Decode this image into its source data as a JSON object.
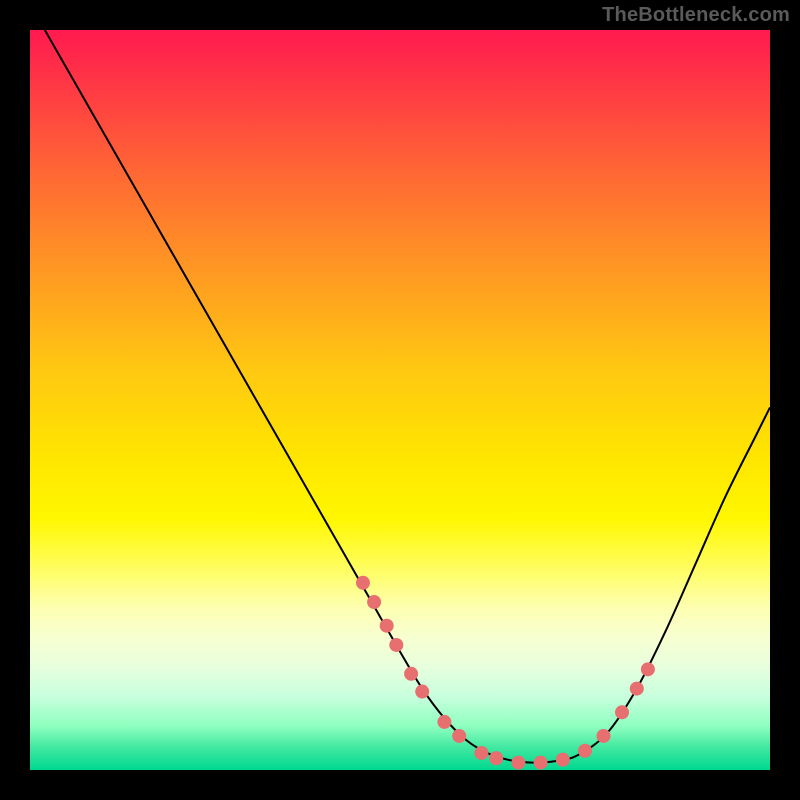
{
  "attribution": "TheBottleneck.com",
  "colors": {
    "background": "#000000",
    "curve": "#000000",
    "dots": "#e76f6f",
    "gradient_top": "#ff1a4f",
    "gradient_bottom": "#00d890"
  },
  "chart_data": {
    "type": "line",
    "title": "",
    "xlabel": "",
    "ylabel": "",
    "xlim": [
      0,
      100
    ],
    "ylim": [
      0,
      100
    ],
    "series": [
      {
        "name": "bottleneck-curve",
        "x": [
          2,
          6,
          10,
          14,
          18,
          22,
          26,
          30,
          34,
          38,
          42,
          46,
          50,
          53,
          56,
          59,
          62,
          65,
          68,
          71,
          74,
          78,
          82,
          86,
          90,
          94,
          98,
          100
        ],
        "y": [
          100,
          93,
          86,
          79,
          72,
          65,
          58,
          51,
          44,
          37,
          30,
          23,
          16,
          11,
          7,
          4,
          2.2,
          1.3,
          1.0,
          1.2,
          2.0,
          5,
          11,
          19,
          28,
          37,
          45,
          49
        ]
      }
    ],
    "highlight_points": {
      "name": "dots",
      "x": [
        45.0,
        46.5,
        48.2,
        49.5,
        51.5,
        53.0,
        56.0,
        58.0,
        61.0,
        63.0,
        66.0,
        69.0,
        72.0,
        75.0,
        77.5,
        80.0,
        82.0,
        83.5
      ],
      "y": [
        25.3,
        22.7,
        19.5,
        16.9,
        13.0,
        10.6,
        6.5,
        4.6,
        2.3,
        1.6,
        1.0,
        1.0,
        1.4,
        2.6,
        4.6,
        7.8,
        11.0,
        13.6
      ]
    },
    "dot_radius": 7
  }
}
